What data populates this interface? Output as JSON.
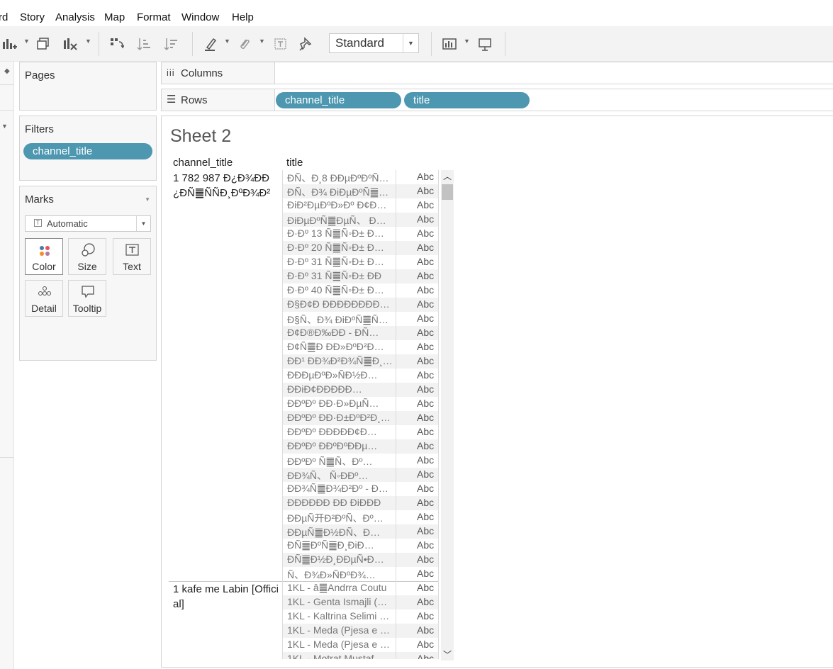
{
  "menu": [
    "rd",
    "Story",
    "Analysis",
    "Map",
    "Format",
    "Window",
    "Help"
  ],
  "toolbar": {
    "fit": "Standard"
  },
  "pages_panel": {
    "title": "Pages"
  },
  "filters_panel": {
    "title": "Filters",
    "pill": "channel_title"
  },
  "marks_panel": {
    "title": "Marks",
    "mark_type": "Automatic",
    "buttons": [
      "Color",
      "Size",
      "Text",
      "Detail",
      "Tooltip"
    ]
  },
  "shelves": {
    "columns_label": "Columns",
    "rows_label": "Rows",
    "rows_pills": [
      "channel_title",
      "title"
    ]
  },
  "sheet": {
    "title": "Sheet 2",
    "headers": [
      "channel_title",
      "title"
    ],
    "abc": "Abc",
    "groups": [
      {
        "label": "1 782 987 Ð¿Ð¾ÐÐ¿ÐÑ䷀ÑÑÐ¸ÐºÐ¾Ð²",
        "rows": [
          "ÐÑ、Ð¸8 ÐÐµÐºÐºÑ…",
          "ÐÑ、Ð¾ ÐiÐµÐºÑ䷀…",
          "ÐiÐ²ÐµÐºÐ»Ðº Ð¢Ð…",
          "ÐiÐµÐºÑ䷀ÐµÑ、 Ð…",
          "Ð·Ðº 13 Ñ䷀Ñ◦Ð± Ð…",
          "Ð·Ðº 20 Ñ䷀Ñ◦Ð± Ð…",
          "Ð·Ðº 31 Ñ䷀Ñ◦Ð± Ð…",
          "Ð·Ðº 31 Ñ䷀Ñ◦Ð± ÐÐ",
          "Ð·Ðº 40 Ñ䷀Ñ◦Ð± Ð…",
          "Ð§Ð¢Ð ÐÐÐÐÐÐÐÐ…",
          "Ð§Ñ、Ð¾ ÐiÐºÑ䷀Ñ…",
          "Ð¢Ð®Ð‰ÐÐ - ÐÑ…",
          "Ð¢Ñ䷀Ð ÐÐ»ÐºÐ²Ð…",
          "ÐÐ¹ ÐÐ¾Ð²Ð¾Ñ䷀Ð¸…",
          "ÐÐÐµÐºÐ»ÑÐ½Ð…",
          "ÐÐiÐ¢ÐÐÐÐÐ…",
          "ÐÐºÐº ÐÐ·Ð»ÐµÑ…",
          "ÐÐºÐº ÐÐ·Ð±ÐºÐ²Ð¸…",
          "ÐÐºÐº ÐÐÐÐÐ¢Ð…",
          "ÐÐºÐº ÐÐºÐºÐÐµ…",
          "ÐÐºÐº Ñ䷀Ñ、Ðº…",
          "ÐÐ¾Ñ、 Ñ◦ÐÐº…",
          "ÐÐ¾Ñ䷀Ð¾Ð²Ðº - Ð…",
          "ÐÐÐÐÐÐ ÐÐ ÐiÐÐÐ",
          "ÐÐµÑ开Ð²ÐºÑ、Ðº…",
          "ÐÐµÑ䷀Ð½ÐÑ、Ð…",
          "ÐÑ䷀ÐºÑ䷀Ð¸ÐiÐ…",
          "ÐÑ䷀Ð½Ð¸ÐÐµÑ•Ð…",
          "Ñ、Ð¾Ð»ÑÐºÐ¾…"
        ]
      },
      {
        "label": "1 kafe me Labin [Official]",
        "rows": [
          "1KL - â䷀Andrra Coutu",
          "1KL - Genta Ismajli (…",
          "1KL - Kaltrina Selimi …",
          "1KL - Meda (Pjesa e …",
          "1KL - Meda (Pjesa e …",
          "1KL - Motrat Mustaf…"
        ]
      }
    ]
  }
}
